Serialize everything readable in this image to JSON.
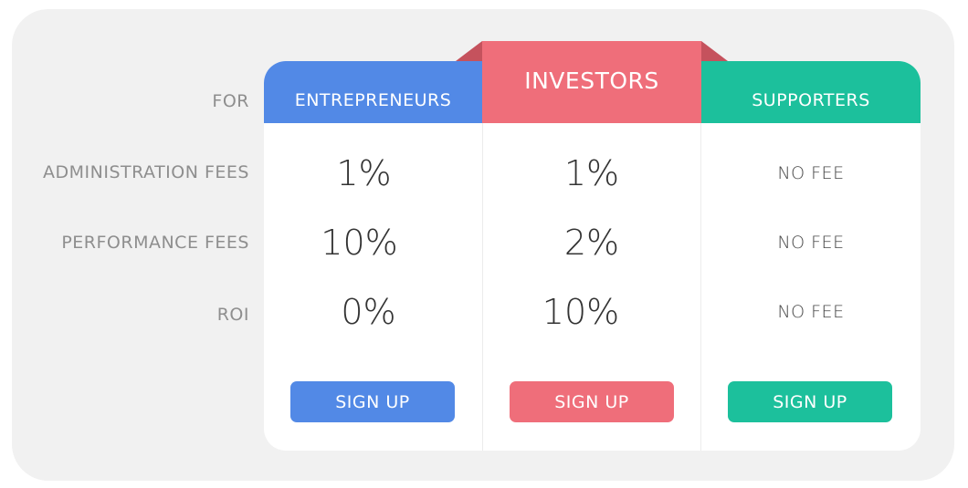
{
  "row_labels": {
    "for": "FOR",
    "administration_fees": "ADMINISTRATION FEES",
    "performance_fees": "PERFORMANCE FEES",
    "roi": "ROI"
  },
  "plans": [
    {
      "name": "ENTREPRENEURS",
      "administration_fees": "1%",
      "performance_fees": "10%",
      "roi": "0%",
      "button_label": "SIGN UP",
      "color": "#5289e6"
    },
    {
      "name": "INVESTORS",
      "administration_fees": "1%",
      "performance_fees": "2%",
      "roi": "10%",
      "button_label": "SIGN UP",
      "color": "#ef6e7a",
      "featured": true
    },
    {
      "name": "SUPPORTERS",
      "administration_fees": "NO FEE",
      "performance_fees": "NO FEE",
      "roi": "NO FEE",
      "button_label": "SIGN UP",
      "color": "#1cc09c"
    }
  ]
}
